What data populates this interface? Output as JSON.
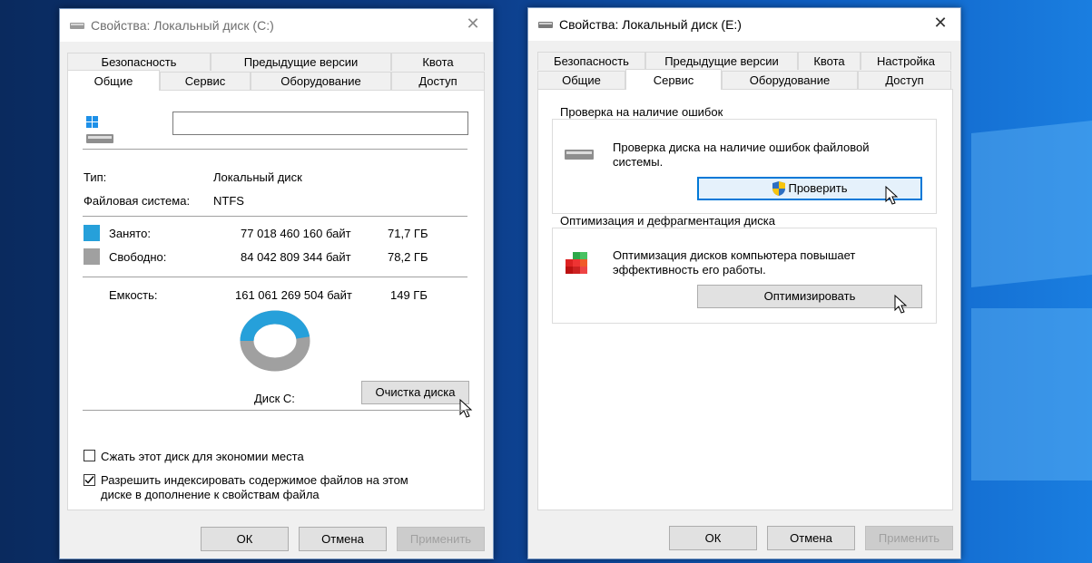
{
  "colors": {
    "used": "#26a0da",
    "free": "#a0a0a0",
    "accent": "#0078d7"
  },
  "left_window": {
    "title": "Свойства: Локальный диск (C:)",
    "tabs_row1": [
      "Безопасность",
      "Предыдущие версии",
      "Квота"
    ],
    "tabs_row2": [
      "Общие",
      "Сервис",
      "Оборудование",
      "Доступ"
    ],
    "active_tab": "Общие",
    "name_value": "",
    "type_label": "Тип:",
    "type_value": "Локальный диск",
    "fs_label": "Файловая система:",
    "fs_value": "NTFS",
    "used_label": "Занято:",
    "used_bytes": "77 018 460 160 байт",
    "used_gb": "71,7 ГБ",
    "free_label": "Свободно:",
    "free_bytes": "84 042 809 344 байт",
    "free_gb": "78,2 ГБ",
    "capacity_label": "Емкость:",
    "capacity_bytes": "161 061 269 504 байт",
    "capacity_gb": "149 ГБ",
    "used_fraction": 0.478,
    "disk_label": "Диск C:",
    "cleanup_button": "Очистка диска",
    "compress_label": "Сжать этот диск для экономии места",
    "compress_checked": false,
    "index_label_line1": "Разрешить индексировать содержимое файлов на этом",
    "index_label_line2": "диске в дополнение к свойствам файла",
    "index_checked": true,
    "ok": "ОК",
    "cancel": "Отмена",
    "apply": "Применить"
  },
  "right_window": {
    "title": "Свойства: Локальный диск (E:)",
    "tabs_row1": [
      "Безопасность",
      "Предыдущие версии",
      "Квота",
      "Настройка"
    ],
    "tabs_row2": [
      "Общие",
      "Сервис",
      "Оборудование",
      "Доступ"
    ],
    "active_tab": "Сервис",
    "check_group_title": "Проверка на наличие ошибок",
    "check_desc_line1": "Проверка диска на наличие ошибок файловой",
    "check_desc_line2": "системы.",
    "check_button": "Проверить",
    "opt_group_title": "Оптимизация и дефрагментация диска",
    "opt_desc_line1": "Оптимизация дисков компьютера повышает",
    "opt_desc_line2": "эффективность его работы.",
    "opt_button": "Оптимизировать",
    "ok": "ОК",
    "cancel": "Отмена",
    "apply": "Применить"
  }
}
